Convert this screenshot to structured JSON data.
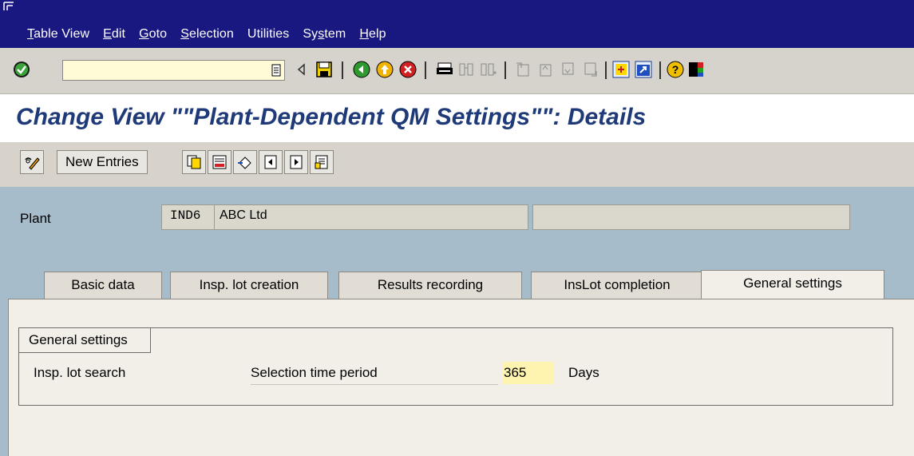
{
  "menu": {
    "items": [
      {
        "pre": "",
        "ul": "T",
        "post": "able View"
      },
      {
        "pre": "",
        "ul": "E",
        "post": "dit"
      },
      {
        "pre": "",
        "ul": "G",
        "post": "oto"
      },
      {
        "pre": "",
        "ul": "S",
        "post": "election"
      },
      {
        "pre": "",
        "ul": "",
        "post": "Utilities"
      },
      {
        "pre": "Sy",
        "ul": "s",
        "post": "tem"
      },
      {
        "pre": "",
        "ul": "H",
        "post": "elp"
      }
    ]
  },
  "toolbar": {
    "command_value": "",
    "icons": [
      "enter-icon",
      "back-icon",
      "save-icon",
      "back-nav-icon",
      "exit-icon",
      "cancel-icon",
      "print-icon",
      "find-icon",
      "find-next-icon",
      "first-page-icon",
      "previous-page-icon",
      "next-page-icon",
      "last-page-icon",
      "create-session-icon",
      "shortcut-icon",
      "help-icon",
      "layout-icon"
    ]
  },
  "title": "Change View \"\"Plant-Dependent QM Settings\"\": Details",
  "app_toolbar": {
    "new_entries": "New Entries"
  },
  "plant": {
    "label": "Plant",
    "code": "IND6",
    "name": "ABC Ltd"
  },
  "tabs": [
    {
      "label": "Basic data",
      "active": false
    },
    {
      "label": "Insp. lot creation",
      "active": false
    },
    {
      "label": "Results recording",
      "active": false
    },
    {
      "label": "InsLot completion",
      "active": false
    },
    {
      "label": "General settings",
      "active": true
    }
  ],
  "group": {
    "title": "General settings",
    "row_label": "Insp. lot search",
    "field_label": "Selection time period",
    "field_value": "365",
    "field_unit": "Days"
  },
  "colors": {
    "menubar": "#181880",
    "title": "#1f3a78",
    "main_bg": "#a7bccb",
    "input_highlight": "#fff3b0"
  }
}
